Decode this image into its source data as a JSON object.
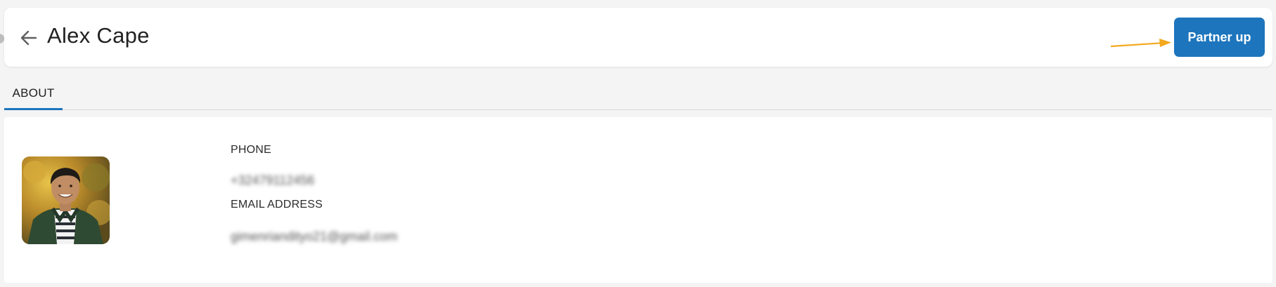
{
  "header": {
    "title": "Alex Cape",
    "action_button_label": "Partner up",
    "back_icon": "arrow-left-icon",
    "annotation_arrow_color": "#f4a81d"
  },
  "tabs": [
    {
      "label": "ABOUT",
      "active": true
    }
  ],
  "profile": {
    "avatar_icon": "user-photo",
    "phone_label": "PHONE",
    "phone_value": "+32479112456",
    "email_label": "EMAIL ADDRESS",
    "email_value": "gimenriandityo21@gmail.com"
  },
  "colors": {
    "accent": "#1d75bd",
    "background": "#f4f4f4",
    "card": "#ffffff"
  }
}
